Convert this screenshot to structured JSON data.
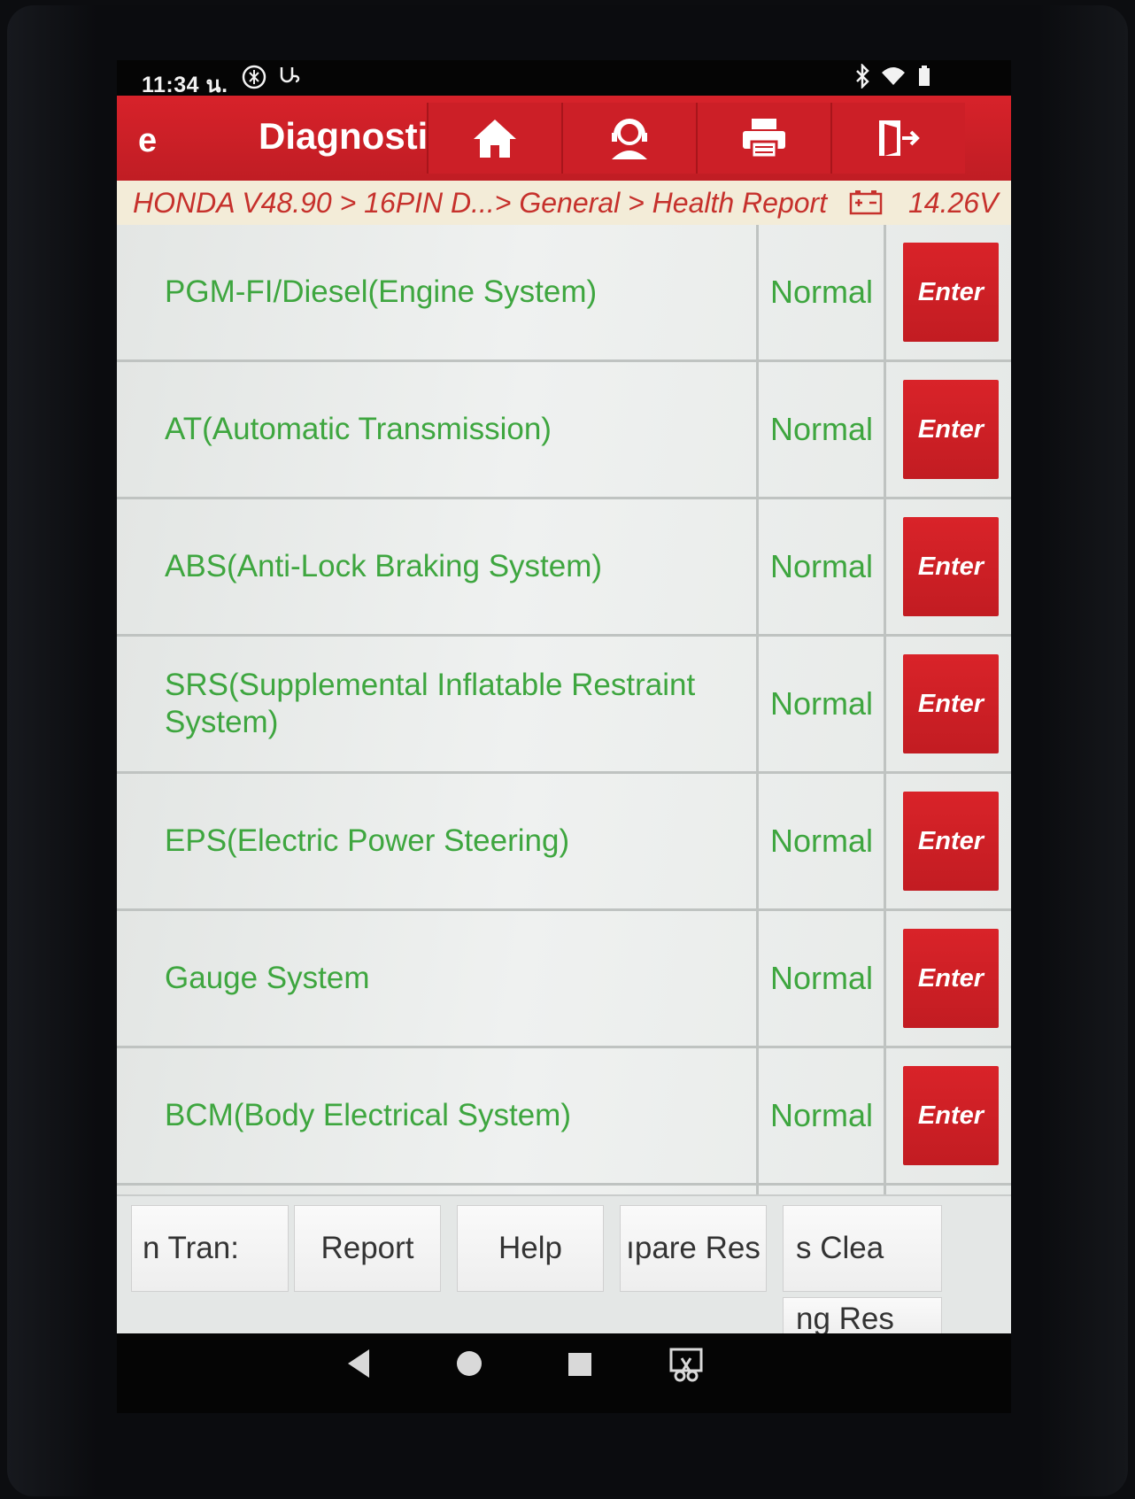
{
  "statusbar": {
    "time": "11:34 น.",
    "icons": [
      "app-indicator-icon",
      "diagnostic-icon",
      "bluetooth-icon",
      "wifi-icon",
      "battery-icon"
    ]
  },
  "titlebar": {
    "left_fragment": "e",
    "title": "Diagnosti",
    "buttons": [
      "home-icon",
      "support-agent-icon",
      "print-icon",
      "exit-icon"
    ]
  },
  "breadcrumb": {
    "path": "HONDA V48.90 > 16PIN D...> General > Health Report",
    "voltage": "14.26V"
  },
  "systems": [
    {
      "name": "PGM-FI/Diesel(Engine System)",
      "status": "Normal",
      "action": "Enter"
    },
    {
      "name": "AT(Automatic Transmission)",
      "status": "Normal",
      "action": "Enter"
    },
    {
      "name": "ABS(Anti-Lock Braking System)",
      "status": "Normal",
      "action": "Enter"
    },
    {
      "name": "SRS(Supplemental Inflatable Restraint System)",
      "status": "Normal",
      "action": "Enter"
    },
    {
      "name": "EPS(Electric Power Steering)",
      "status": "Normal",
      "action": "Enter"
    },
    {
      "name": "Gauge System",
      "status": "Normal",
      "action": "Enter"
    },
    {
      "name": "BCM(Body Electrical System)",
      "status": "Normal",
      "action": "Enter"
    }
  ],
  "bottom_buttons": {
    "trans": "n    Tran:",
    "report": "Report",
    "help": "Help",
    "compare": "ıpare Res",
    "clear": "s    Clea",
    "res": "ng    Res"
  },
  "colors": {
    "header_red": "#cc1f27",
    "status_green": "#3ea63f",
    "breadcrumb_text": "#c6312c",
    "breadcrumb_bg": "#f3ecd8"
  }
}
